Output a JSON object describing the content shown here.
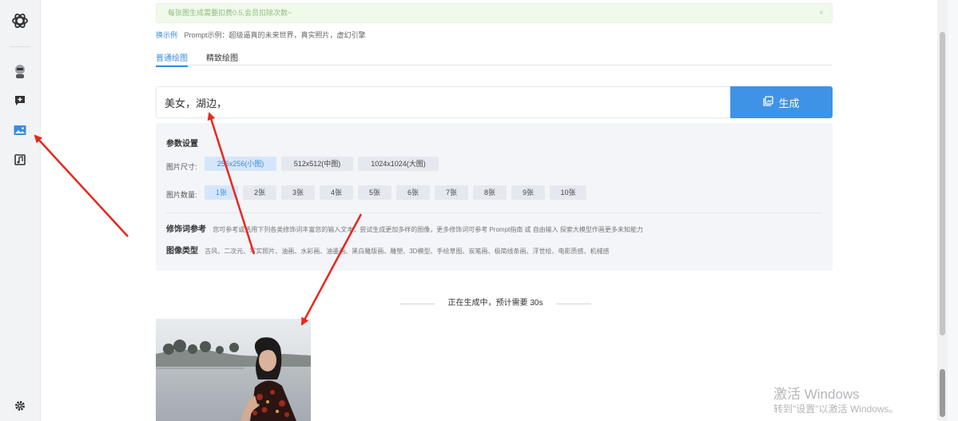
{
  "notice": {
    "text": "每张图生成需要扣费0.5,会员扣除次数~",
    "close": "×"
  },
  "example": {
    "link": "换示例",
    "text": "Prompt示例：超级逼真的未来世界，真实照片，虚幻引擎"
  },
  "tabs": [
    {
      "label": "普通绘图"
    },
    {
      "label": "精致绘图"
    }
  ],
  "prompt": {
    "value": "美女，湖边，",
    "button_label": "生成"
  },
  "params": {
    "title": "参数设置",
    "size_label": "图片尺寸:",
    "sizes": [
      "256x256(小图)",
      "512x512(中图)",
      "1024x1024(大图)"
    ],
    "selected_size": "256x256(小图)",
    "count_label": "图片数量:",
    "counts": [
      "1张",
      "2张",
      "3张",
      "4张",
      "5张",
      "6张",
      "7张",
      "8张",
      "9张",
      "10张"
    ],
    "selected_count": "1张",
    "modifier": {
      "title": "修饰词参考",
      "desc": "您可参考或选用下列各类修饰词丰富您的输入文本，尝试生成更加多样的图像，更多修饰词可参考 Prompt指南 或 自由输入 探索大模型作画更多未知能力"
    },
    "style": {
      "title": "图像类型",
      "items": "古风、二次元、写实照片、油画、水彩画、油墨画、黑白雕版画、雕塑、3D模型、手绘草图、炭笔画、极简线条画、浮世绘、电影质感、机械感"
    }
  },
  "status": {
    "text": "正在生成中，预计需要 30s"
  },
  "watermark": {
    "line1": "激活 Windows",
    "line2": "转到\"设置\"以激活 Windows。"
  },
  "colors": {
    "accent": "#3f93e7",
    "annotation_arrow": "#e8271e"
  },
  "icons": {
    "sidebar": [
      "openai-logo-icon",
      "avatar-icon",
      "chat-add-icon",
      "image-gallery-icon",
      "music-icon",
      "settings-gear-icon"
    ],
    "generate": "image-stack-icon"
  }
}
